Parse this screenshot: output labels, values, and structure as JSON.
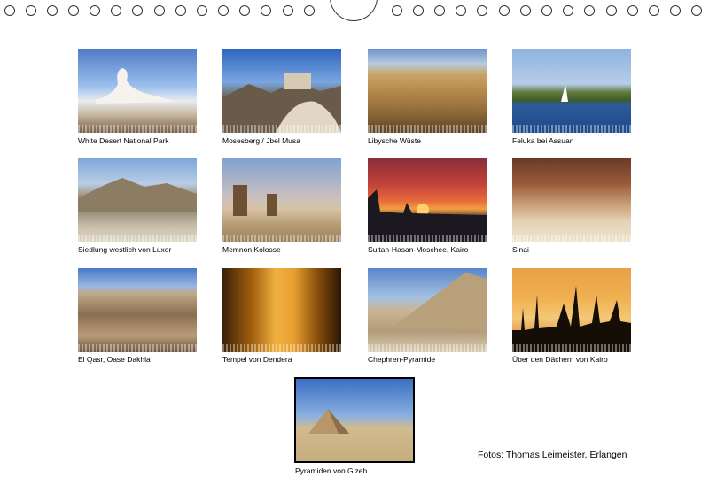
{
  "photos": [
    {
      "caption": "White Desert National Park"
    },
    {
      "caption": "Mosesberg / Jbel Musa"
    },
    {
      "caption": "Libysche Wüste"
    },
    {
      "caption": "Feluka bei Assuan"
    },
    {
      "caption": "Siedlung westlich von Luxor"
    },
    {
      "caption": "Memnon Kolosse"
    },
    {
      "caption": "Sultan-Hasan-Moschee, Kairo"
    },
    {
      "caption": "Sinai"
    },
    {
      "caption": "El Qasr, Oase Dakhla"
    },
    {
      "caption": "Tempel von Dendera"
    },
    {
      "caption": "Chephren-Pyramide"
    },
    {
      "caption": "Über den Dächern von Kairo"
    }
  ],
  "featured": {
    "caption": "Pyramiden von Gizeh"
  },
  "credit": "Fotos: Thomas Leimeister, Erlangen"
}
